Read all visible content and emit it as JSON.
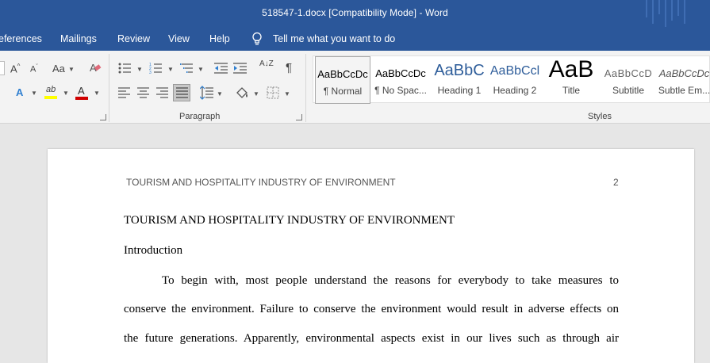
{
  "window": {
    "title": "518547-1.docx [Compatibility Mode]  -  Word"
  },
  "menu": {
    "tabs": [
      "eferences",
      "Mailings",
      "Review",
      "View",
      "Help"
    ],
    "tell_me": "Tell me what you want to do"
  },
  "ribbon": {
    "paragraph_label": "Paragraph",
    "styles_label": "Styles",
    "styles": [
      {
        "sample": "AaBbCcDc",
        "name": "¶ Normal"
      },
      {
        "sample": "AaBbCcDc",
        "name": "¶ No Spac..."
      },
      {
        "sample": "AaBbC",
        "name": "Heading 1"
      },
      {
        "sample": "AaBbCcl",
        "name": "Heading 2"
      },
      {
        "sample": "AaB",
        "name": "Title"
      },
      {
        "sample": "AaBbCcD",
        "name": "Subtitle"
      },
      {
        "sample": "AaBbCcDc",
        "name": "Subtle Em..."
      }
    ],
    "icons": {
      "grow_font": "A",
      "shrink_font": "A",
      "change_case": "Aa",
      "text_effects": "A",
      "highlight": "ab",
      "font_color": "A",
      "sort": "A↓Z",
      "pilcrow": "¶"
    },
    "colors": {
      "highlight": "#ffff00",
      "font_color": "#d00000",
      "brand": "#2b579a"
    }
  },
  "document": {
    "header_text": "TOURISM AND HOSPITALITY INDUSTRY OF ENVIRONMENT",
    "page_number": "2",
    "title": "TOURISM AND HOSPITALITY INDUSTRY OF ENVIRONMENT",
    "section_heading": "Introduction",
    "lines": [
      "To begin with, most people understand the reasons for everybody to take measures to",
      "conserve the environment. Failure to conserve the environment would result in adverse effects on",
      "the future generations. Apparently, environmental aspects exist in our lives such as through air"
    ]
  }
}
